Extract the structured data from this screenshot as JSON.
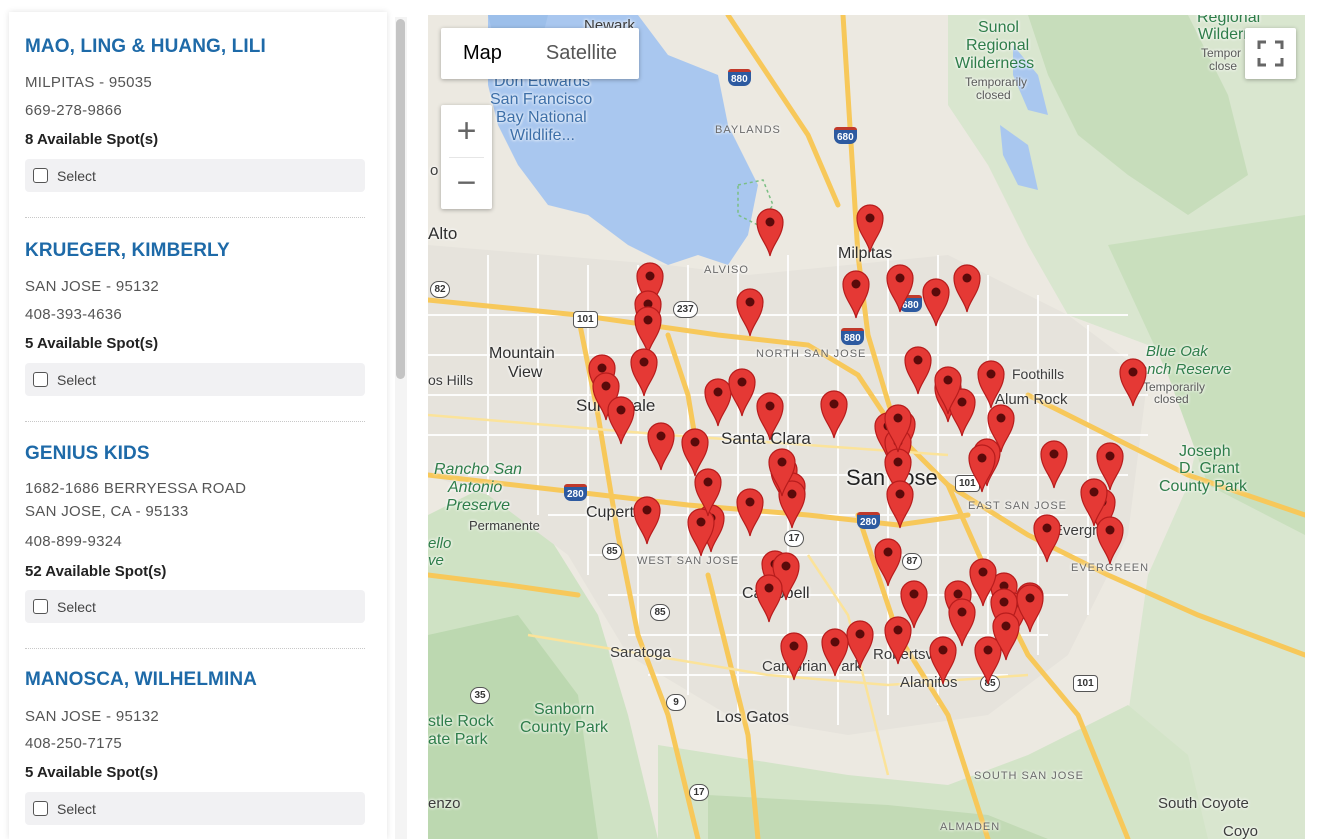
{
  "providers": [
    {
      "name": "MAO, LING & HUANG, LILI",
      "address_lines": [
        "MILPITAS - 95035"
      ],
      "phone": "669-278-9866",
      "spots": "8 Available Spot(s)",
      "select_label": "Select"
    },
    {
      "name": "KRUEGER, KIMBERLY",
      "address_lines": [
        "SAN JOSE - 95132"
      ],
      "phone": "408-393-4636",
      "spots": "5 Available Spot(s)",
      "select_label": "Select"
    },
    {
      "name": "GENIUS KIDS",
      "address_lines": [
        "1682-1686 BERRYESSA ROAD",
        "SAN JOSE, CA - 95133"
      ],
      "phone": "408-899-9324",
      "spots": "52 Available Spot(s)",
      "select_label": "Select"
    },
    {
      "name": "MANOSCA, WILHELMINA",
      "address_lines": [
        "SAN JOSE - 95132"
      ],
      "phone": "408-250-7175",
      "spots": "5 Available Spot(s)",
      "select_label": "Select"
    }
  ],
  "map": {
    "type_buttons": [
      "Map",
      "Satellite"
    ],
    "active_type": "Map",
    "zoom_in": "+",
    "zoom_out": "−",
    "labels": {
      "newark": "Newark",
      "sunol": "Sunol",
      "sunol2": "Regional",
      "sunol3": "Wilderness",
      "sunol4": "Temporarily",
      "sunol5": "closed",
      "regional": "Regional",
      "wilderness": "Wilderr",
      "tempo": "Tempor",
      "close": "close",
      "don": "Don Edwards",
      "sf": "San Francisco",
      "bay": "Bay National",
      "wild": "Wildlife...",
      "baylands": "BAYLANDS",
      "alviso": "ALVISO",
      "milpitas": "Milpitas",
      "alto": "Alto",
      "mountain": "Mountain",
      "view": "View",
      "oshills": "os Hills",
      "northsj": "NORTH SAN JOSE",
      "sunnyvale": "Sunnyvale",
      "santaclara": "Santa Clara",
      "sanjose": "San Jose",
      "foothills": "Foothills",
      "alumrock": "Alum Rock",
      "blueoak": "Blue Oak",
      "ranch": "Ranch Reserve",
      "blueoaktemp": "Temporarily",
      "blueoakclosed": "closed",
      "joseph": "Joseph",
      "dgrant": "D. Grant",
      "countypark": "County Park",
      "rancho": "Rancho San",
      "antonio": "Antonio",
      "preserve": "Preserve",
      "permanente": "Permanente",
      "cupertino": "Cupertino",
      "eastsj": "EAST SAN JOSE",
      "evergreen": "Evergreen",
      "evergreen2": "EVERGREEN",
      "westsj": "WEST SAN JOSE",
      "campbell": "Campbell",
      "saratoga": "Saratoga",
      "cambrian": "Cambrian Park",
      "robertsville": "Robertsville",
      "alamitos": "Alamitos",
      "sanborn": "Sanborn",
      "sanborn2": "County Park",
      "stlerock": "stle Rock",
      "atepark": "ate Park",
      "losgatos": "Los Gatos",
      "southsj": "SOUTH SAN JOSE",
      "southcoyote": "South Coyote",
      "almaden": "ALMADEN",
      "enzo": "enzo",
      "ello": "ello",
      "ve": "ve",
      "coyo": "Coyo",
      "o": "o"
    },
    "shields": {
      "i880a": "880",
      "i680": "680",
      "i880b": "880",
      "i680b": "680",
      "i280": "280",
      "i280b": "280",
      "r82": "82",
      "r237": "237",
      "us101a": "101",
      "us101b": "101",
      "us101c": "101",
      "r85": "85",
      "r85b": "85",
      "r85c": "85",
      "r87": "87",
      "r17": "17",
      "r17b": "17",
      "r9": "9",
      "r35": "35"
    },
    "marker_count": 82,
    "colors": {
      "marker": "#e53935",
      "water": "#a9c7ef",
      "park": "#c8dfc0",
      "highway": "#f7c85a",
      "land": "#ece9e1"
    }
  }
}
